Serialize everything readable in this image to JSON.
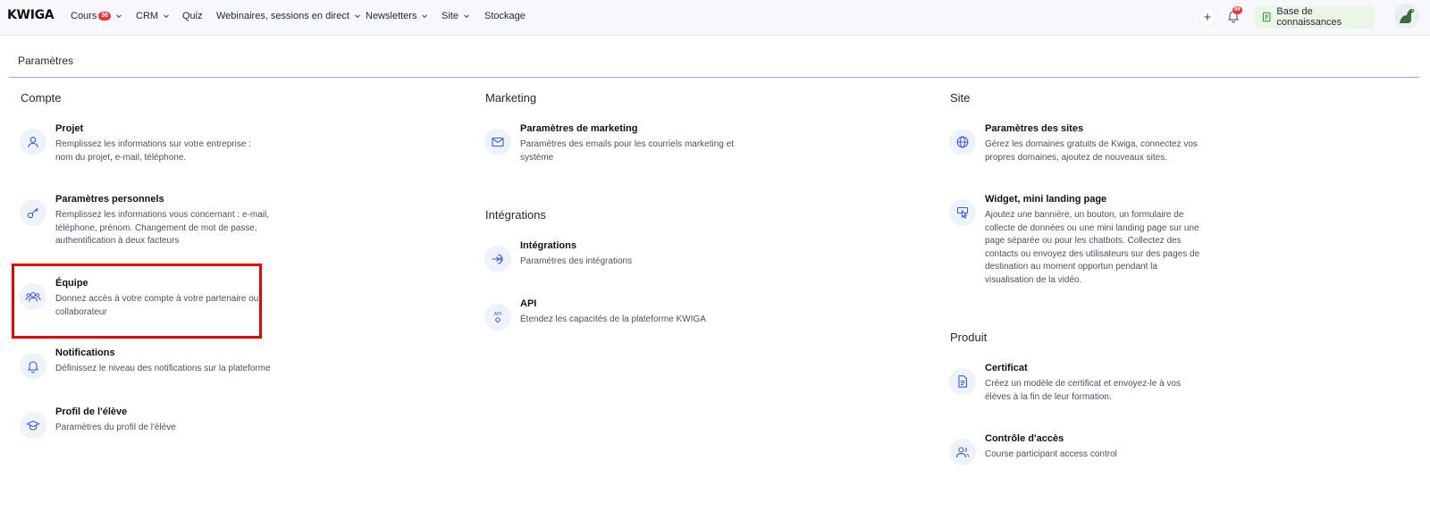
{
  "topbar": {
    "logo": "KWIGA",
    "nav": [
      {
        "label": "Cours",
        "badge": "36",
        "has_chevron": true
      },
      {
        "label": "CRM",
        "has_chevron": true
      },
      {
        "label": "Quiz",
        "has_chevron": false
      },
      {
        "label": "Webinaires, sessions en direct",
        "has_chevron": true
      },
      {
        "label": "Newsletters",
        "has_chevron": true
      },
      {
        "label": "Site",
        "has_chevron": true
      },
      {
        "label": "Stockage",
        "has_chevron": false
      }
    ],
    "add_icon": "plus-icon",
    "notifications_badge": "99",
    "knowledge_base_label": "Base de connaissances"
  },
  "page": {
    "title": "Paramètres"
  },
  "sections": {
    "compte": {
      "title": "Compte",
      "items": [
        {
          "title": "Projet",
          "desc": "Remplissez les informations sur votre entreprise : nom du projet, e-mail, téléphone.",
          "icon": "user-icon"
        },
        {
          "title": "Paramètres personnels",
          "desc": "Remplissez les informations vous concernant : e-mail, téléphone, prénom. Changement de mot de passe, authentification à deux facteurs",
          "icon": "key-icon"
        },
        {
          "title": "Équipe",
          "desc": "Donnez accès à votre compte à votre partenaire ou collaborateur",
          "icon": "team-icon"
        },
        {
          "title": "Notifications",
          "desc": "Définissez le niveau des notifications sur la plateforme",
          "icon": "bell-icon"
        },
        {
          "title": "Profil de l'élève",
          "desc": "Paramètres du profil de l'élève",
          "icon": "graduation-cap-icon"
        }
      ]
    },
    "marketing": {
      "title": "Marketing",
      "items": [
        {
          "title": "Paramètres de marketing",
          "desc": "Paramètres des emails pour les courriels marketing et système",
          "icon": "mail-icon"
        }
      ]
    },
    "integrations": {
      "title": "Intégrations",
      "items": [
        {
          "title": "Intégrations",
          "desc": "Paramètres des intégrations",
          "icon": "integration-icon"
        },
        {
          "title": "API",
          "desc": "Étendez les capacités de la plateforme KWIGA",
          "icon": "api-icon"
        }
      ]
    },
    "site": {
      "title": "Site",
      "items": [
        {
          "title": "Paramètres des sites",
          "desc": "Gérez les domaines gratuits de Kwiga, connectez vos propres domaines, ajoutez de nouveaux sites.",
          "icon": "globe-icon"
        },
        {
          "title": "Widget, mini landing page",
          "desc": "Ajoutez une bannière, un bouton, un formulaire de collecte de données ou une mini landing page sur une page séparée ou pour les chatbots. Collectez des contacts ou envoyez des utilisateurs sur des pages de destination au moment opportun pendant la visualisation de la vidéo.",
          "icon": "widget-icon"
        }
      ]
    },
    "produit": {
      "title": "Produit",
      "items": [
        {
          "title": "Certificat",
          "desc": "Créez un modèle de certificat et envoyez-le à vos élèves à la fin de leur formation.",
          "icon": "certificate-icon"
        },
        {
          "title": "Contrôle d'accès",
          "desc": "Course participant access control",
          "icon": "access-control-icon"
        }
      ]
    }
  },
  "colors": {
    "accent": "#3b5bdb",
    "highlight": "#e60000",
    "badge": "#e5383b",
    "kb_background": "#eaf6e6"
  }
}
